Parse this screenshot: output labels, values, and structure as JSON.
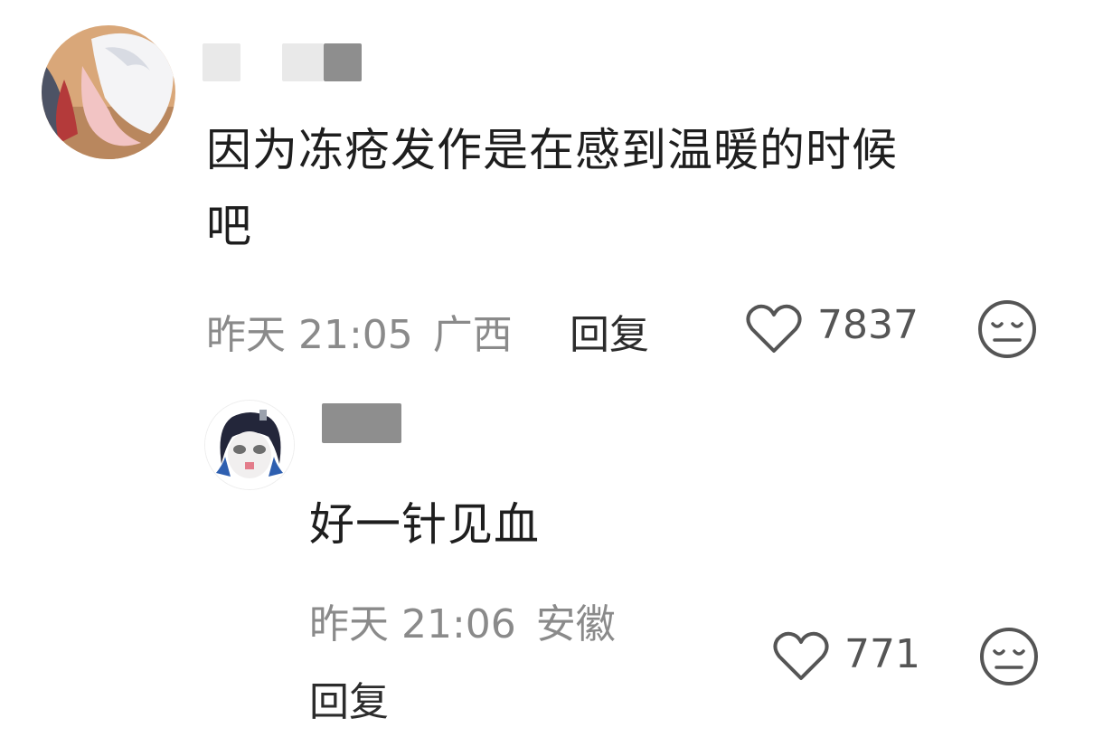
{
  "comments": [
    {
      "text_line1": "因为冻疮发作是在感到温暖的时候",
      "text_line2": "吧",
      "time": "昨天 21:05",
      "location": "广西",
      "reply_label": "回复",
      "likes": "7837",
      "like_icon": "heart-outline-icon",
      "dislike_icon": "meh-face-icon"
    }
  ],
  "replies": [
    {
      "text": "好一针见血",
      "time": "昨天 21:06",
      "location": "安徽",
      "reply_label": "回复",
      "likes": "771",
      "like_icon": "heart-outline-icon",
      "dislike_icon": "meh-face-icon"
    }
  ],
  "colors": {
    "meta_gray": "#8a8a8a",
    "text_dark": "#1e1e1e",
    "icon_gray": "#555555"
  }
}
